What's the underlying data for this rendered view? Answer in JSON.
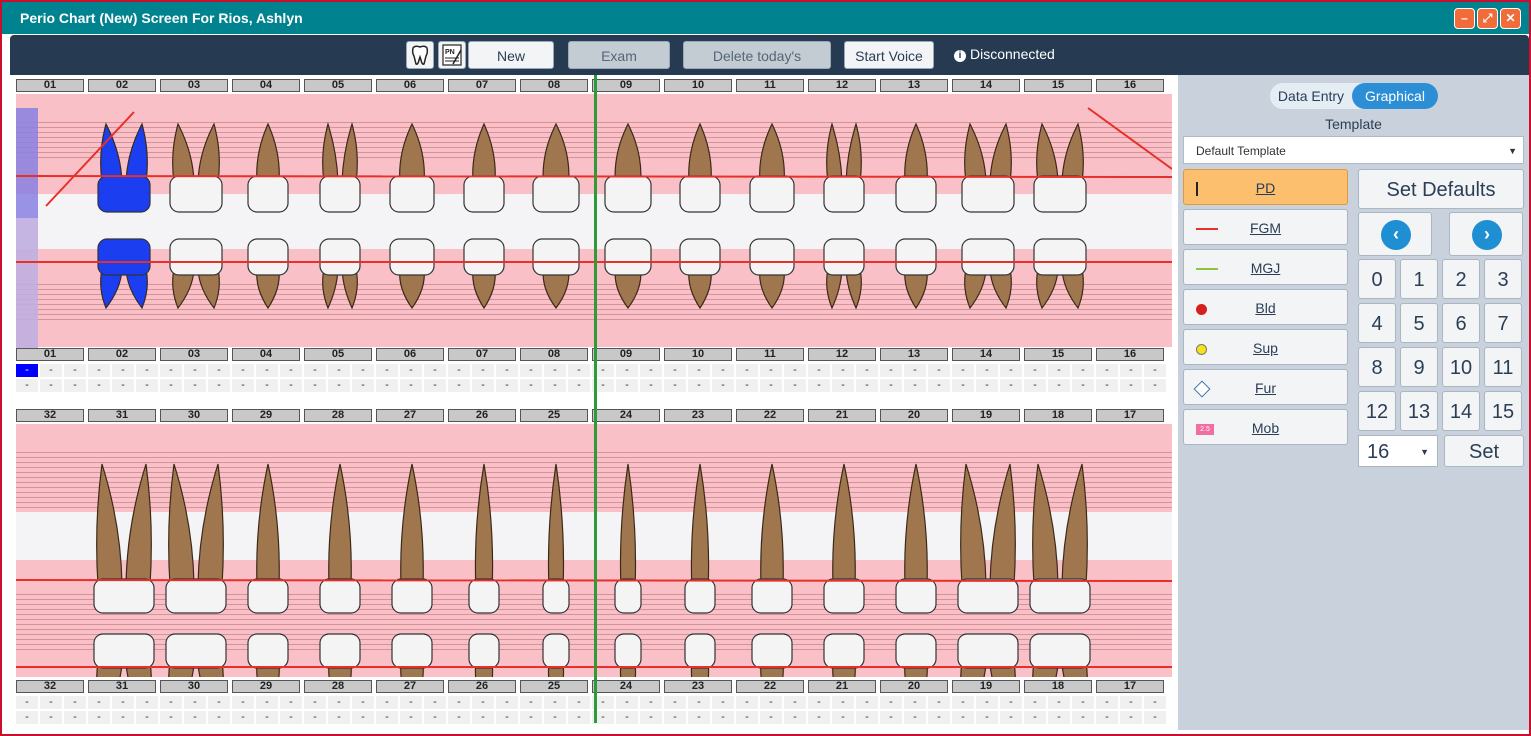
{
  "window": {
    "title": "Perio Chart (New) Screen For Rios, Ashlyn",
    "minimize_icon": "minimize-icon",
    "restore_icon": "restore-icon",
    "close_icon": "close-icon"
  },
  "toolbar": {
    "tooth_icon": "tooth-icon",
    "pn_icon": "progress-notes-icon",
    "new_exam": "New Exam",
    "exam_details": "Exam Details",
    "delete_exam": "Delete today's Exam",
    "start_voice": "Start Voice",
    "status": "Disconnected",
    "status_icon": "info-icon"
  },
  "chart": {
    "upper_teeth": [
      "01",
      "02",
      "03",
      "04",
      "05",
      "06",
      "07",
      "08",
      "09",
      "10",
      "11",
      "12",
      "13",
      "14",
      "15",
      "16"
    ],
    "lower_teeth": [
      "32",
      "31",
      "30",
      "29",
      "28",
      "27",
      "26",
      "25",
      "24",
      "23",
      "22",
      "21",
      "20",
      "19",
      "18",
      "17"
    ],
    "dash": "-",
    "colors": {
      "gum": "#f9c1c7",
      "gum_line": "#e8302a",
      "midline": "#2e9a3a",
      "tooth_root": "#a0764e",
      "tooth_crown": "#f4f4f4",
      "implant": "#1a3ef0",
      "missing_bar": "#8a80e0"
    }
  },
  "panel": {
    "view_toggle": [
      "Data Entry",
      "Graphical"
    ],
    "selected_view": "Graphical",
    "template_label": "Template",
    "template_value": "Default Template",
    "modes": [
      {
        "label": "PD",
        "icon": "cursor-icon",
        "active": true
      },
      {
        "label": "FGM",
        "icon": "red-line-icon",
        "active": false
      },
      {
        "label": "MGJ",
        "icon": "green-line-icon",
        "active": false
      },
      {
        "label": "Bld",
        "icon": "red-dot-icon",
        "active": false
      },
      {
        "label": "Sup",
        "icon": "yellow-dot-icon",
        "active": false
      },
      {
        "label": "Fur",
        "icon": "diamond-icon",
        "active": false
      },
      {
        "label": "Mob",
        "icon": "mobility-icon",
        "active": false
      }
    ],
    "set_defaults": "Set Defaults",
    "prev_icon": "chevron-left-icon",
    "next_icon": "chevron-right-icon",
    "numbers": [
      "0",
      "1",
      "2",
      "3",
      "4",
      "5",
      "6",
      "7",
      "8",
      "9",
      "10",
      "11",
      "12",
      "13",
      "14",
      "15"
    ],
    "number_select": "16",
    "set": "Set"
  }
}
